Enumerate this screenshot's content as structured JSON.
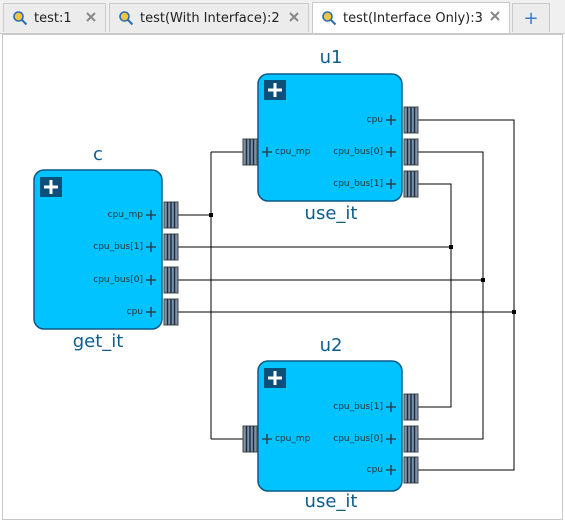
{
  "tabs": [
    {
      "label": "test:1",
      "active": false
    },
    {
      "label": "test(With Interface):2",
      "active": false
    },
    {
      "label": "test(Interface Only):3",
      "active": true
    }
  ],
  "add_tab_label": "+",
  "diagram": {
    "block_fill": "#00c3ff",
    "block_stroke": "#0a5a8a",
    "title_color": "#0e5c8c",
    "blocks": [
      {
        "id": "c",
        "instance": "c",
        "module": "get_it",
        "ports": [
          "cpu_mp",
          "cpu_bus[1]",
          "cpu_bus[0]",
          "cpu"
        ]
      },
      {
        "id": "u1",
        "instance": "u1",
        "module": "use_it",
        "left_ports": [
          "cpu_mp"
        ],
        "right_ports": [
          "cpu",
          "cpu_bus[0]",
          "cpu_bus[1]"
        ]
      },
      {
        "id": "u2",
        "instance": "u2",
        "module": "use_it",
        "left_ports": [
          "cpu_mp"
        ],
        "right_ports": [
          "cpu_bus[1]",
          "cpu_bus[0]",
          "cpu"
        ]
      }
    ]
  }
}
